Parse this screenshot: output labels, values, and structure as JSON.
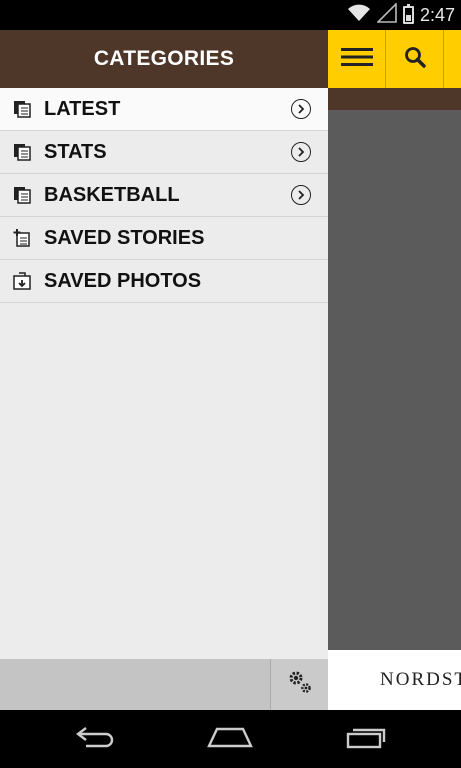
{
  "status_bar": {
    "time": "2:47",
    "icons": [
      "wifi-icon",
      "signal-icon",
      "battery-charging-icon"
    ]
  },
  "drawer": {
    "title": "CATEGORIES",
    "items": [
      {
        "label": "LATEST",
        "icon": "news-icon",
        "has_arrow": true
      },
      {
        "label": "STATS",
        "icon": "news-icon",
        "has_arrow": true
      },
      {
        "label": "BASKETBALL",
        "icon": "news-icon",
        "has_arrow": true
      },
      {
        "label": "SAVED STORIES",
        "icon": "saved-story-icon",
        "has_arrow": false
      },
      {
        "label": "SAVED PHOTOS",
        "icon": "saved-photo-icon",
        "has_arrow": false
      }
    ],
    "footer_icon": "settings-gears-icon"
  },
  "main": {
    "toolbar": {
      "menu_icon": "hamburger-menu-icon",
      "search_icon": "search-icon"
    },
    "ad_text": "NORDSTROM"
  },
  "nav_bar": {
    "buttons": [
      "back-icon",
      "home-icon",
      "recents-icon"
    ]
  },
  "colors": {
    "brand_brown": "#4e3629",
    "brand_gold": "#ffcd00",
    "drawer_bg": "#ececec",
    "content_bg": "#5b5b5b"
  }
}
